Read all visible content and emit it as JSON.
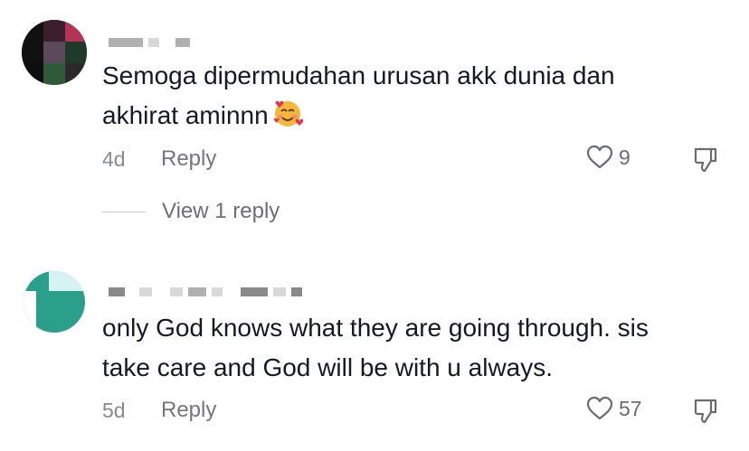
{
  "comments": [
    {
      "text": "Semoga dipermudahan urusan akk dunia dan\nakhirat aminnn",
      "emoji": "smiling-face-with-hearts",
      "age": "4d",
      "reply_label": "Reply",
      "likes": "9",
      "view_replies": "View 1 reply"
    },
    {
      "text": "only God knows what they are going through. sis\ntake care and God will be with u always.",
      "age": "5d",
      "reply_label": "Reply",
      "likes": "57"
    }
  ],
  "colors": {
    "text": "#161823",
    "muted": "#8a8b91",
    "avatar2": "#2a9f8a"
  }
}
